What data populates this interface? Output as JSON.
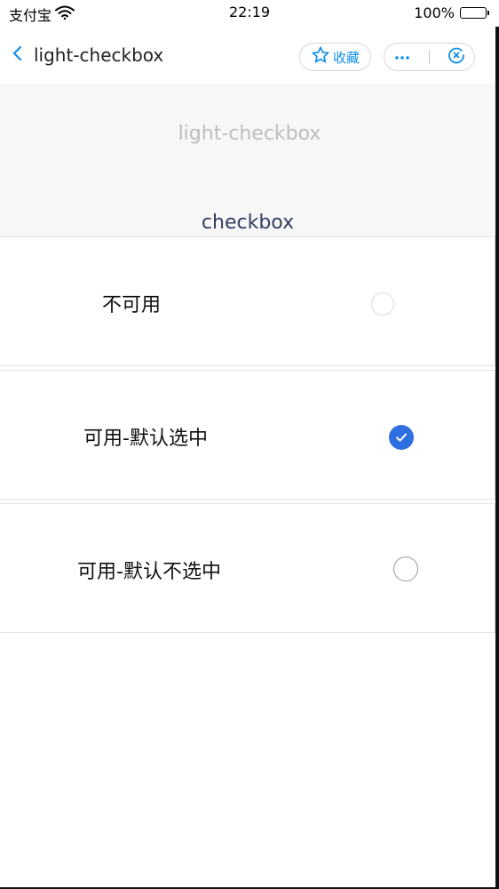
{
  "status_bar": {
    "carrier": "支付宝",
    "time": "22:19",
    "battery_text": "100%",
    "battery_level": 1.0
  },
  "nav": {
    "title": "light-checkbox",
    "favorite_label": "收藏",
    "accent_color": "#108ee9"
  },
  "header": {
    "heading": "light-checkbox",
    "section_label": "checkbox"
  },
  "checkboxes": [
    {
      "label": "不可用",
      "state": "disabled"
    },
    {
      "label": "可用-默认选中",
      "state": "checked"
    },
    {
      "label": "可用-默认不选中",
      "state": "unchecked"
    }
  ],
  "colors": {
    "checked": "#2f6fe0",
    "heading_gray": "#bdbdbd",
    "section_label": "#333e63"
  },
  "icons": [
    "wifi-icon",
    "battery-icon",
    "back-chevron-icon",
    "star-icon",
    "more-icon",
    "close-mini-program-icon",
    "checkmark-icon"
  ]
}
